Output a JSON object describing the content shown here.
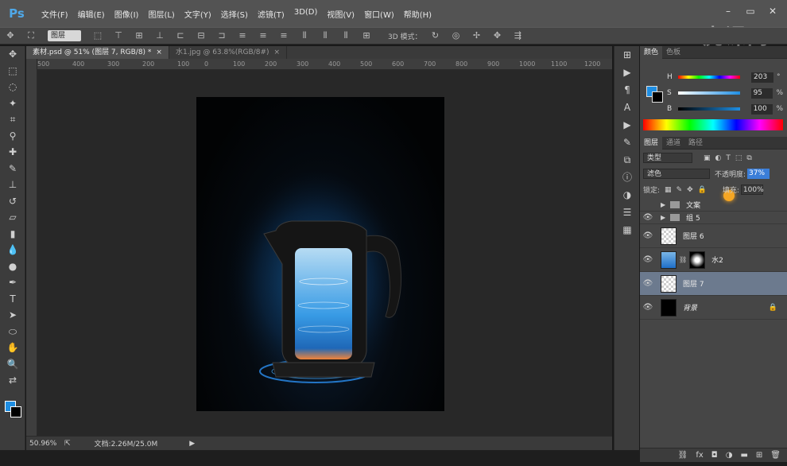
{
  "app": {
    "logo": "Ps",
    "menu": [
      "文件(F)",
      "编辑(E)",
      "图像(I)",
      "图层(L)",
      "文字(Y)",
      "选择(S)",
      "滤镜(T)",
      "3D(D)",
      "视图(V)",
      "窗口(W)",
      "帮助(H)"
    ],
    "watermark": "虎课网"
  },
  "options": {
    "layer_select": "图层",
    "mode_3d_label": "3D 模式："
  },
  "documents": {
    "tabs": [
      {
        "label": "素材.psd @ 51% (图层 7, RGB/8) *",
        "active": true
      },
      {
        "label": "水1.jpg @ 63.8%(RGB/8#)",
        "active": false
      }
    ],
    "ruler_ticks": [
      "500",
      "400",
      "300",
      "200",
      "100",
      "0",
      "100",
      "200",
      "300",
      "400",
      "500",
      "600",
      "700",
      "800",
      "900",
      "1000",
      "1100",
      "1200"
    ]
  },
  "status": {
    "zoom": "50.96%",
    "doc_info": "文档:2.26M/25.0M"
  },
  "color_panel": {
    "tabs": [
      "颜色",
      "色板"
    ],
    "fg_color": "#1e8ee3",
    "bg_color": "#000000",
    "rows": [
      {
        "label": "H",
        "value": "203",
        "unit": "°"
      },
      {
        "label": "S",
        "value": "95",
        "unit": "%"
      },
      {
        "label": "B",
        "value": "100",
        "unit": "%"
      }
    ]
  },
  "layers_panel": {
    "tabs": [
      "图层",
      "通道",
      "路径"
    ],
    "filter_kind": "类型",
    "blend_mode": "滤色",
    "opacity_label": "不透明度:",
    "opacity_value": "37%",
    "lock_label": "锁定:",
    "fill_label": "填充:",
    "fill_value": "100%",
    "layers": [
      {
        "name": "文案",
        "type": "group"
      },
      {
        "name": "组 5",
        "type": "group"
      },
      {
        "name": "图层 6",
        "type": "layer"
      },
      {
        "name": "水2",
        "type": "masked"
      },
      {
        "name": "图层 7",
        "type": "layer",
        "selected": true
      },
      {
        "name": "背景",
        "type": "background"
      }
    ]
  }
}
